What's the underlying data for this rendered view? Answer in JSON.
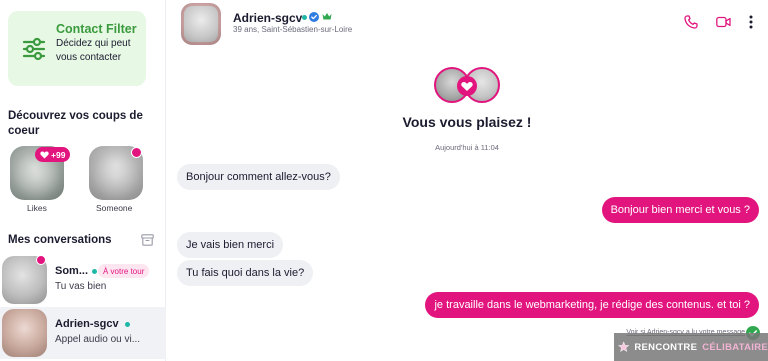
{
  "sidebar": {
    "filter": {
      "title": "Contact Filter",
      "description": "Décidez qui peut vous contacter",
      "icon": "sliders-icon"
    },
    "likes_section": {
      "title": "Découvrez vos coups de coeur",
      "items": [
        {
          "label": "Likes",
          "badge": "+99",
          "badge_icon": "heart-icon"
        },
        {
          "label": "Someone",
          "has_new_dot": true
        }
      ]
    },
    "conversations": {
      "title": "Mes conversations",
      "items": [
        {
          "name": "Som...",
          "online": true,
          "tag": "À votre tour",
          "preview": "Tu vas bien",
          "unread": true
        },
        {
          "name": "Adrien-sgcv",
          "online": true,
          "preview": "Appel audio ou vi...",
          "active": true
        }
      ]
    }
  },
  "header": {
    "name": "Adrien-sgcv",
    "subtitle": "39 ans, Saint-Sébastien-sur-Loire",
    "icons": [
      "verified-icon",
      "crown-icon",
      "phone-icon",
      "video-icon",
      "more-vertical-icon"
    ]
  },
  "chat": {
    "match_title": "Vous vous plaisez !",
    "match_time": "Aujourd'hui à 11:04",
    "messages": [
      {
        "direction": "in",
        "text": "Bonjour comment allez-vous?"
      },
      {
        "direction": "out",
        "text": "Bonjour bien merci et vous ?"
      },
      {
        "direction": "in",
        "text": "Je vais bien merci"
      },
      {
        "direction": "in",
        "text": "Tu fais quoi dans la vie?"
      },
      {
        "direction": "out",
        "text": "je travaille dans le webmarketing, je rédige des contenus. et toi ?"
      }
    ],
    "seen_text": "Voir si Adrien-sgcv a lu votre message"
  },
  "watermark": {
    "part1": "RENCONTRE",
    "part2": "CÉLIBATAIRE"
  },
  "colors": {
    "accent": "#e2157f",
    "green": "#3a9a3d",
    "online": "#1fb7a6",
    "bubble_in": "#eef0f4"
  }
}
